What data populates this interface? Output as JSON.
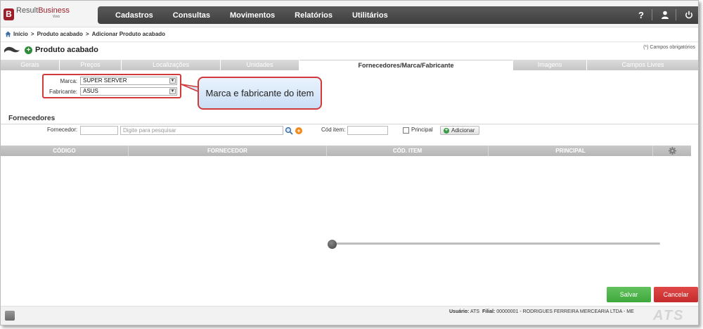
{
  "app": {
    "logo_letter": "B",
    "logo_name_part1": "Result",
    "logo_name_part2": "Business",
    "logo_sub": "Web"
  },
  "nav": {
    "items": [
      "Cadastros",
      "Consultas",
      "Movimentos",
      "Relatórios",
      "Utilitários"
    ],
    "help_icon": "?",
    "user_icon": "user-icon",
    "power_icon": "power-icon"
  },
  "breadcrumb": {
    "home": "Início",
    "separator": ">",
    "items": [
      "Produto acabado",
      "Adicionar Produto acabado"
    ]
  },
  "page": {
    "title": "Produto acabado",
    "required_note": "(*) Campos obrigatórios"
  },
  "tabs": [
    {
      "label": "Gerais",
      "active": false
    },
    {
      "label": "Preços",
      "active": false
    },
    {
      "label": "Localizações",
      "active": false
    },
    {
      "label": "Unidades",
      "active": false
    },
    {
      "label": "Fornecedores/Marca/Fabricante",
      "active": true
    },
    {
      "label": "Imagens",
      "active": false
    },
    {
      "label": "Campos Livres",
      "active": false
    }
  ],
  "form": {
    "marca_label": "Marca:",
    "marca_value": "SUPER SERVER",
    "fabricante_label": "Fabricante:",
    "fabricante_value": "ASUS"
  },
  "callout": {
    "text": "Marca e fabricante do item"
  },
  "fornecedores": {
    "section_title": "Fornecedores",
    "fornecedor_label": "Fornecedor:",
    "search_placeholder": "Digite para pesquisar",
    "cod_item_label": "Cód item:",
    "principal_label": "Principal",
    "add_button": "Adicionar",
    "columns": [
      "CÓDIGO",
      "FORNECEDOR",
      "CÓD. ITEM",
      "PRINCIPAL"
    ],
    "rows": []
  },
  "actions": {
    "save": "Salvar",
    "cancel": "Cancelar"
  },
  "status": {
    "user_label": "Usuário:",
    "user_value": "ATS",
    "branch_label": "Filial:",
    "branch_value": "00000001 - RODRIGUES FERREIRA MERCEARIA LTDA - ME",
    "brand": "ATS"
  },
  "colors": {
    "brand": "#9c1e2a",
    "nav_bg": "#4a4a4a",
    "highlight_border": "#d23939",
    "save": "#4cb447",
    "cancel": "#d43535"
  }
}
